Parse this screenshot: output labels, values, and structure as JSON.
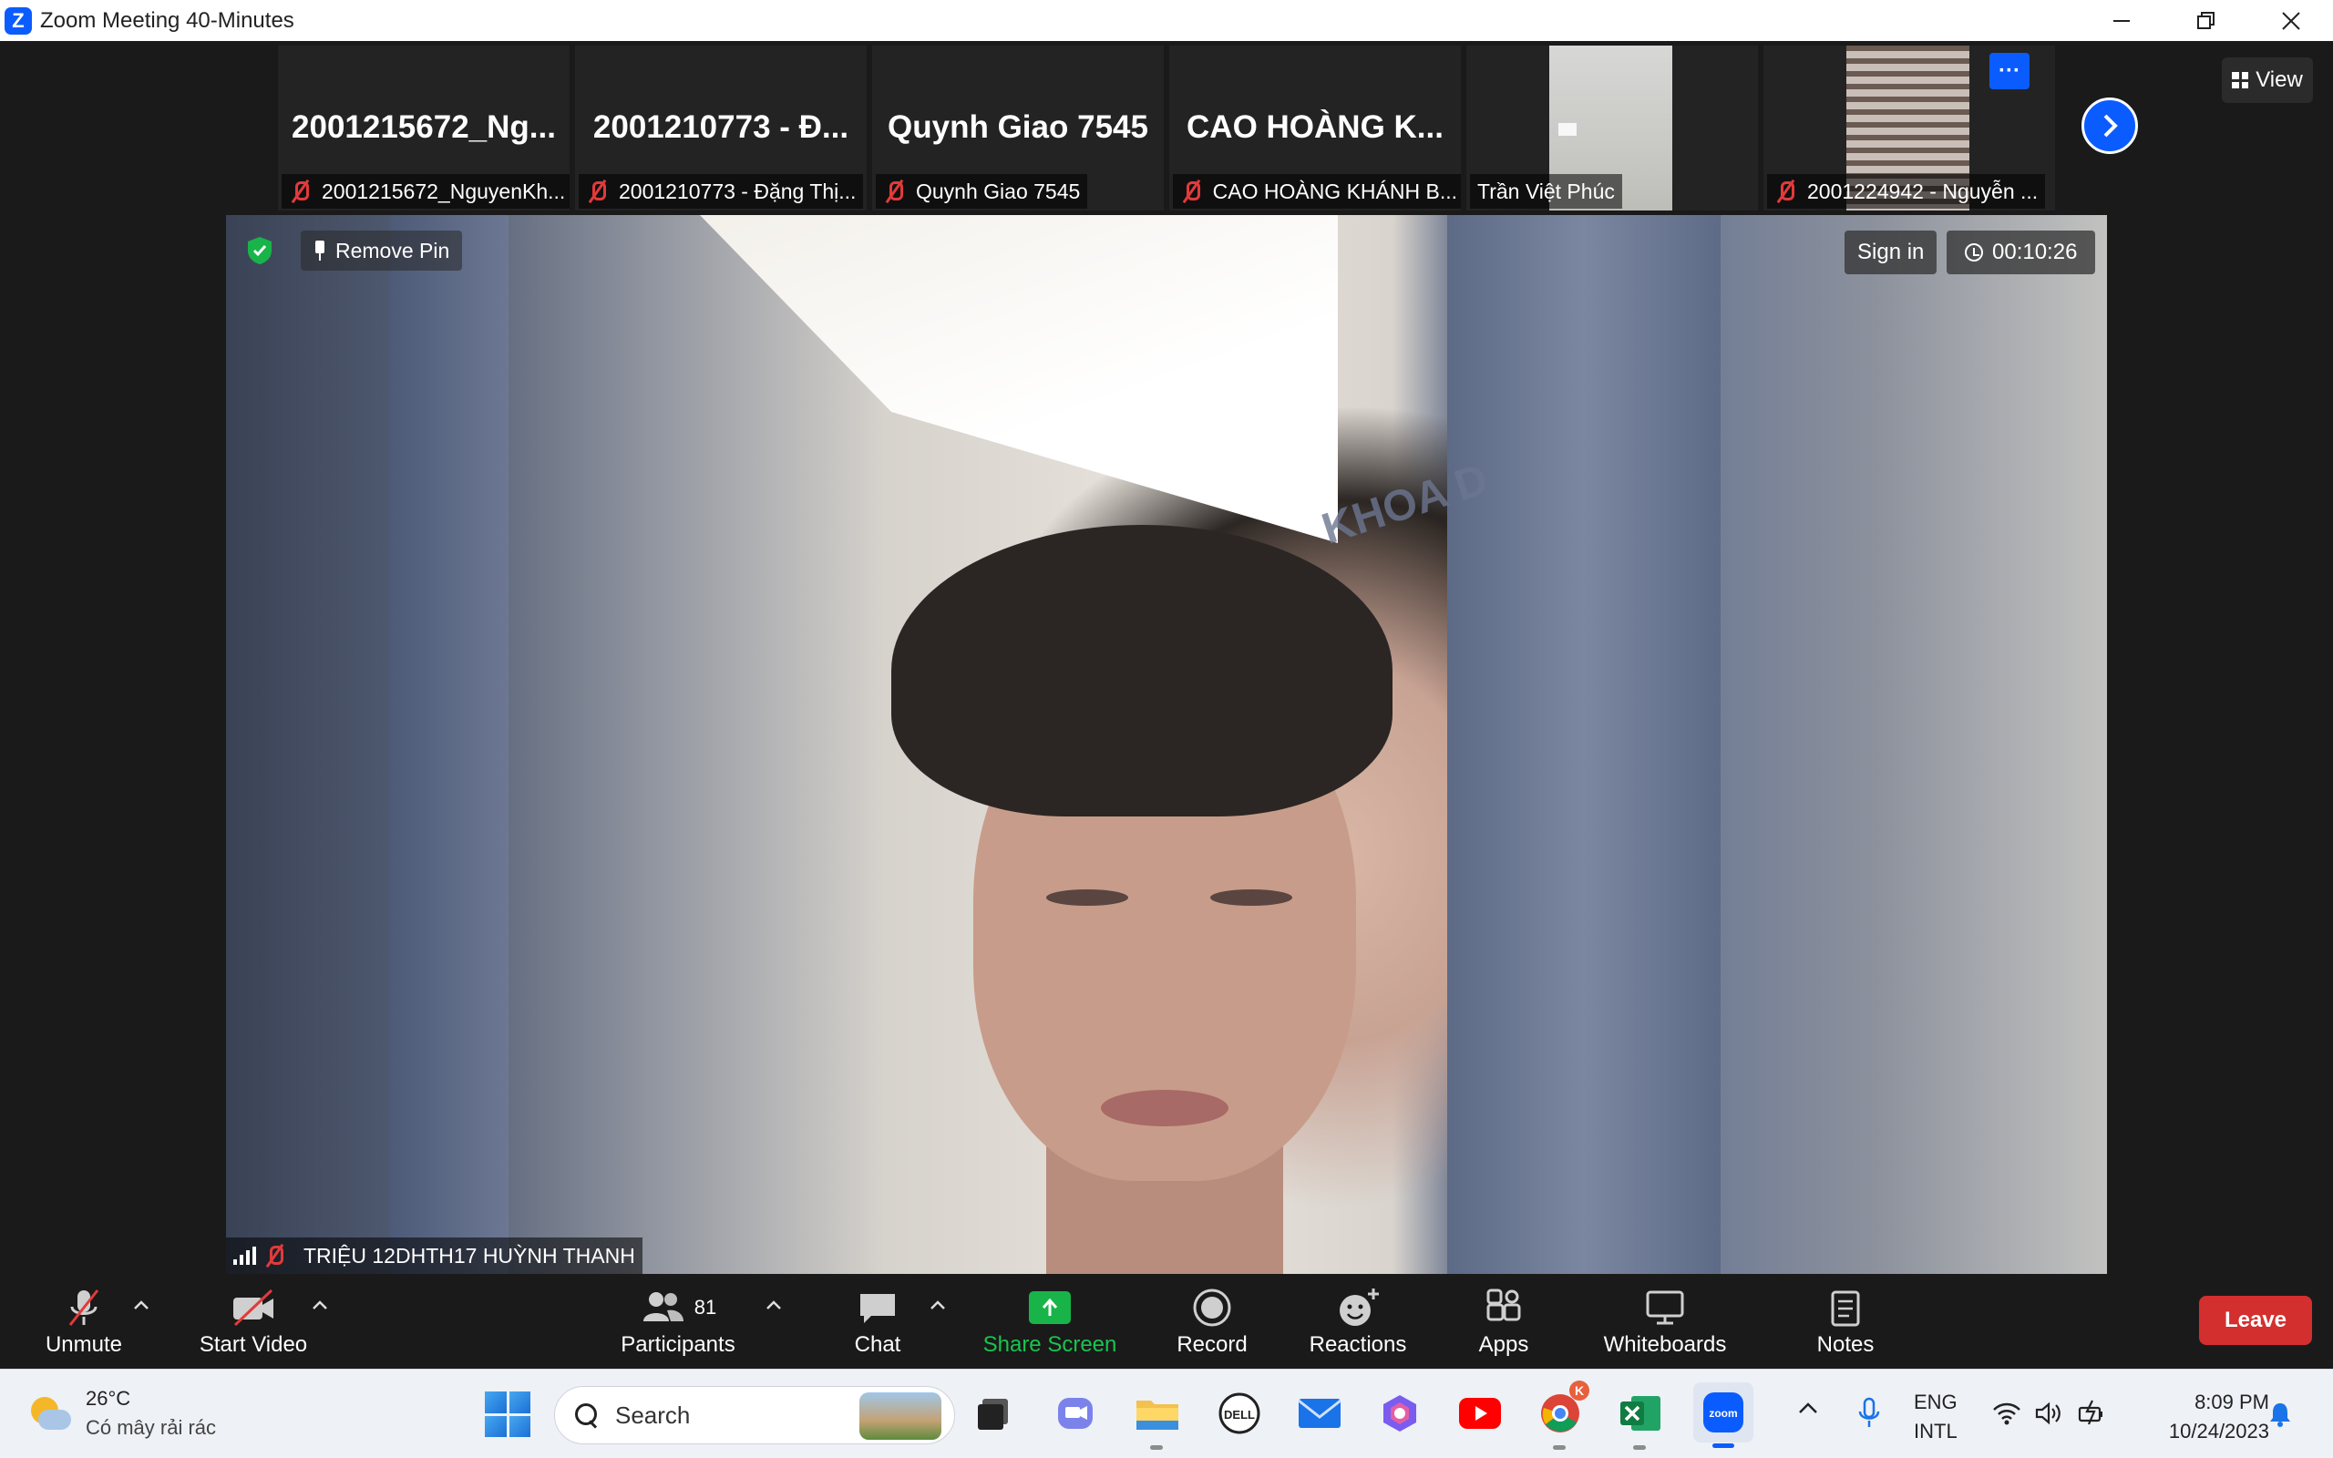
{
  "window": {
    "title": "Zoom Meeting 40-Minutes",
    "logo": "Z"
  },
  "gallery": {
    "tiles": [
      {
        "name": "2001215672_Ng...",
        "label": "2001215672_NguyenKh...",
        "muted": true
      },
      {
        "name": "2001210773 - Đ...",
        "label": "2001210773 - Đặng Thị...",
        "muted": true
      },
      {
        "name": "Quynh Giao 7545",
        "label": "Quynh Giao 7545",
        "muted": true
      },
      {
        "name": "CAO HOÀNG K...",
        "label": "CAO HOÀNG KHÁNH B...",
        "muted": true
      },
      {
        "name": "",
        "label": "Trần Việt Phúc",
        "muted": false
      },
      {
        "name": "",
        "label": "2001224942 - Nguyễn ...",
        "muted": true
      }
    ],
    "more_label": "···",
    "view_label": "View"
  },
  "main_video": {
    "remove_pin": "Remove Pin",
    "sign_in": "Sign in",
    "timer": "00:10:26",
    "wall_text": "KHOA D",
    "participant_name": "TRIỆU 12DHTH17 HUỲNH THANH"
  },
  "toolbar": {
    "unmute": "Unmute",
    "start_video": "Start Video",
    "participants": "Participants",
    "participants_count": "81",
    "chat": "Chat",
    "share_screen": "Share Screen",
    "record": "Record",
    "reactions": "Reactions",
    "apps": "Apps",
    "whiteboards": "Whiteboards",
    "notes": "Notes",
    "leave": "Leave"
  },
  "taskbar": {
    "temperature": "26°C",
    "weather_desc": "Có mây rải rác",
    "search_label": "Search",
    "lang_top": "ENG",
    "lang_bottom": "INTL",
    "time": "8:09 PM",
    "date": "10/24/2023",
    "chrome_badge": "K",
    "dell_label": "DELL",
    "zoom_label": "zoom"
  },
  "colors": {
    "zoom_blue": "#0b5cff",
    "leave_red": "#d32f2f",
    "share_green": "#18b44a",
    "muted_red": "#e23a3a"
  }
}
